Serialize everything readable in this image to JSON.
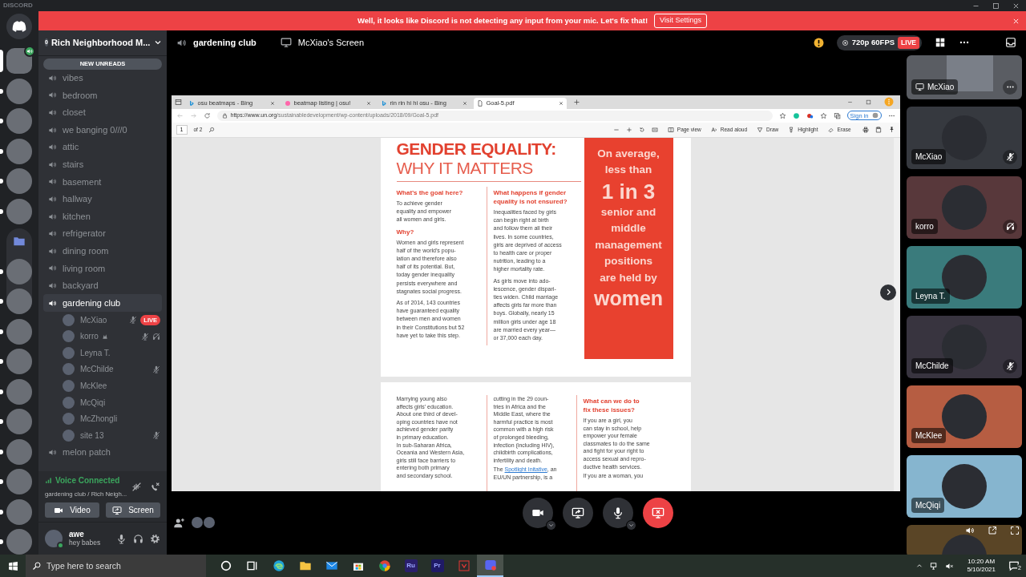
{
  "app": {
    "title": "DISCORD"
  },
  "notice": {
    "text": "Well, it looks like Discord is not detecting any input from your mic. Let's fix that!",
    "button": "Visit Settings"
  },
  "servers": [
    {
      "kind": "home",
      "selected": false,
      "unread": false,
      "in_voice": false
    },
    {
      "kind": "photo",
      "selected": true,
      "unread": false,
      "in_voice": true
    },
    {
      "kind": "photo",
      "selected": false,
      "unread": true,
      "in_voice": false
    },
    {
      "kind": "photo",
      "selected": false,
      "unread": true,
      "in_voice": false
    },
    {
      "kind": "photo",
      "selected": false,
      "unread": true,
      "in_voice": false
    },
    {
      "kind": "photo",
      "selected": false,
      "unread": true,
      "in_voice": false
    },
    {
      "kind": "photo",
      "selected": false,
      "unread": true,
      "in_voice": false
    },
    {
      "kind": "folder",
      "selected": false,
      "unread": false,
      "in_voice": false,
      "children": [
        {
          "kind": "photo",
          "selected": false,
          "unread": true,
          "in_voice": false
        },
        {
          "kind": "photo",
          "selected": false,
          "unread": true,
          "in_voice": false
        }
      ]
    },
    {
      "kind": "photo",
      "selected": false,
      "unread": true,
      "in_voice": false
    },
    {
      "kind": "photo",
      "selected": false,
      "unread": true,
      "in_voice": false
    },
    {
      "kind": "photo",
      "selected": false,
      "unread": true,
      "in_voice": false
    },
    {
      "kind": "photo",
      "selected": false,
      "unread": true,
      "in_voice": false
    },
    {
      "kind": "photo",
      "selected": false,
      "unread": true,
      "in_voice": false
    },
    {
      "kind": "photo",
      "selected": false,
      "unread": true,
      "in_voice": false
    },
    {
      "kind": "photo",
      "selected": false,
      "unread": true,
      "in_voice": false
    },
    {
      "kind": "photo",
      "selected": false,
      "unread": true,
      "in_voice": false
    }
  ],
  "server": {
    "name": "Rich Neighborhood M...",
    "boosts": "0",
    "new_unreads": "NEW UNREADS"
  },
  "channels": [
    {
      "name": "vibes",
      "selected": false
    },
    {
      "name": "bedroom",
      "selected": false
    },
    {
      "name": "closet",
      "selected": false
    },
    {
      "name": "we banging 0///0",
      "selected": false
    },
    {
      "name": "attic",
      "selected": false
    },
    {
      "name": "stairs",
      "selected": false
    },
    {
      "name": "basement",
      "selected": false
    },
    {
      "name": "hallway",
      "selected": false
    },
    {
      "name": "kitchen",
      "selected": false
    },
    {
      "name": "refrigerator",
      "selected": false
    },
    {
      "name": "dining room",
      "selected": false
    },
    {
      "name": "living room",
      "selected": false
    },
    {
      "name": "backyard",
      "selected": false
    },
    {
      "name": "gardening club",
      "selected": true,
      "members": [
        {
          "name": "McXiao",
          "muted": true,
          "deafened": false,
          "live": "LIVE"
        },
        {
          "name": "korro",
          "muted": true,
          "deafened": true
        },
        {
          "name": "Leyna T.",
          "muted": false,
          "deafened": false
        },
        {
          "name": "McChilde",
          "muted": true,
          "deafened": false
        },
        {
          "name": "McKlee",
          "muted": false,
          "deafened": false
        },
        {
          "name": "McQiqi",
          "muted": false,
          "deafened": false
        },
        {
          "name": "McZhongli",
          "muted": false,
          "deafened": false
        },
        {
          "name": "site 13",
          "muted": true,
          "deafened": false
        }
      ]
    },
    {
      "name": "melon patch",
      "selected": false
    }
  ],
  "voice": {
    "status": "Voice Connected",
    "location": "gardening club / Rich Neigh...",
    "buttons": [
      {
        "kind": "video",
        "label": "Video"
      },
      {
        "kind": "screen",
        "label": "Screen"
      }
    ]
  },
  "user": {
    "name": "awe",
    "status": "hey babes"
  },
  "header": {
    "channel": "gardening club",
    "stream": "McXiao's Screen",
    "quality": "720p 60FPS",
    "live": "LIVE"
  },
  "browser": {
    "tabs": [
      {
        "kind": "bing",
        "label": "osu beatmaps - Bing",
        "selected": false
      },
      {
        "kind": "osu",
        "label": "beatmap listing | osu!",
        "selected": false
      },
      {
        "kind": "bing",
        "label": "rin rin hi hi osu - Bing",
        "selected": false
      },
      {
        "kind": "doc",
        "label": "Goal-5.pdf",
        "selected": true
      }
    ],
    "url_host": "https://www.un.org",
    "url_path": "/sustainabledevelopment/wp-content/uploads/2018/09/Goal-5.pdf",
    "sign_in": "Sign in",
    "page": "1",
    "page_count": "of 2",
    "tools": [
      {
        "kind": "pageview",
        "label": "Page view"
      },
      {
        "kind": "read",
        "label": "Read aloud"
      },
      {
        "kind": "draw",
        "label": "Draw"
      },
      {
        "kind": "highlight",
        "label": "Highlight"
      },
      {
        "kind": "erase",
        "label": "Erase"
      }
    ]
  },
  "document": {
    "title": [
      "GENDER EQUALITY:",
      "WHY IT MATTERS"
    ],
    "page1_columns": [
      [
        {
          "kind": "heading",
          "lines": [
            "What’s the goal here?"
          ]
        },
        {
          "kind": "para",
          "lines": [
            "To achieve gender",
            "equality and empower",
            "all women and girls."
          ]
        },
        {
          "kind": "heading",
          "lines": [
            "Why?"
          ]
        },
        {
          "kind": "para",
          "lines": [
            "Women and girls represent",
            "half of the world’s popu-",
            "lation and therefore also",
            "half of its potential. But,",
            "today gender inequality",
            "persists everywhere and",
            "stagnates social progress."
          ]
        },
        {
          "kind": "para",
          "lines": [
            "As of 2014, 143 countries",
            "have guaranteed equality",
            "between men and women",
            "in their Constitutions but 52",
            "have yet to take this step."
          ]
        }
      ],
      [
        {
          "kind": "heading",
          "lines": [
            "What happens if gender",
            "equality is not ensured?"
          ]
        },
        {
          "kind": "para",
          "lines": [
            "Inequalities faced by girls",
            "can begin right at birth",
            "and follow them all their",
            "lives. In some countries,",
            "girls are deprived of access",
            "to health care or proper",
            "nutrition, leading to a",
            "higher mortality rate."
          ]
        },
        {
          "kind": "para",
          "lines": [
            "As girls move into ado-",
            "lescence, gender dispari-",
            "ties widen. Child marriage",
            "affects girls far more than",
            "boys. Globally, nearly 15",
            "million girls under age 18",
            "are married every year—",
            "or 37,000 each day."
          ]
        }
      ]
    ],
    "callout": [
      {
        "kind": "normal",
        "text": "On average,"
      },
      {
        "kind": "normal",
        "text": "less than"
      },
      {
        "kind": "big",
        "text": "1 in 3"
      },
      {
        "kind": "normal",
        "text": "senior and"
      },
      {
        "kind": "normal",
        "text": "middle"
      },
      {
        "kind": "normal",
        "text": "management"
      },
      {
        "kind": "normal",
        "text": "positions"
      },
      {
        "kind": "normal",
        "text": "are held by"
      },
      {
        "kind": "large",
        "text": "women"
      }
    ],
    "page2_columns": [
      [
        {
          "kind": "para",
          "lines": [
            "Marrying young also",
            "affects girls’ education.",
            "About one third of devel-",
            "oping countries have not",
            "achieved gender parity",
            "in primary education.",
            "In sub-Saharan Africa,",
            "Oceania and Western Asia,",
            "girls still face barriers to",
            "entering both primary",
            "and secondary school."
          ]
        }
      ],
      [
        {
          "kind": "para",
          "lines": [
            "cutting in the 29 coun-",
            "tries in Africa and the",
            "Middle East, where the",
            "harmful practice is most",
            "common with a high risk",
            "of prolonged bleeding,",
            "infection (including HIV),",
            "childbirth complications,",
            "infertility and death."
          ]
        },
        {
          "kind": "para",
          "lines": [
            {
              "before": "The ",
              "link": "Spotlight Initative",
              "after": ", an"
            },
            "EU/UN partnership, is a"
          ]
        }
      ],
      [
        {
          "kind": "heading",
          "lines": [
            "What can we do to",
            "fix these issues?"
          ]
        },
        {
          "kind": "para",
          "lines": [
            "If you are a girl, you",
            "can stay in school, help",
            "empower your female",
            "classmates to do the same",
            "and fight for your right to",
            "access sexual and repro-",
            "ductive health services."
          ]
        },
        {
          "kind": "para",
          "lines": [
            "If you are a woman, you"
          ]
        }
      ]
    ]
  },
  "tiles": [
    {
      "kind": "stream",
      "name": "McXiao",
      "color": "#5a5d63",
      "muted": false,
      "deafened": false
    },
    {
      "kind": "user",
      "name": "McXiao",
      "color": "#36393f",
      "muted": true,
      "deafened": false
    },
    {
      "kind": "user",
      "name": "korro",
      "color": "#58383b",
      "muted": false,
      "deafened": true
    },
    {
      "kind": "user",
      "name": "Leyna T.",
      "color": "#3a7b7c",
      "muted": false,
      "deafened": false
    },
    {
      "kind": "user",
      "name": "McChilde",
      "color": "#38343f",
      "muted": true,
      "deafened": false
    },
    {
      "kind": "user",
      "name": "McKlee",
      "color": "#b65d42",
      "muted": false,
      "deafened": false
    },
    {
      "kind": "user",
      "name": "McQiqi",
      "color": "#86b5cf",
      "muted": false,
      "deafened": false
    },
    {
      "kind": "partial",
      "color": "#5a4526",
      "muted": false,
      "deafened": false
    }
  ],
  "taskbar": {
    "search_placeholder": "Type here to search",
    "apps": [
      {
        "kind": "cortana",
        "selected": false
      },
      {
        "kind": "taskview",
        "selected": false
      },
      {
        "kind": "edge",
        "selected": false
      },
      {
        "kind": "explorer",
        "selected": false
      },
      {
        "kind": "mail",
        "selected": false
      },
      {
        "kind": "store",
        "selected": false
      },
      {
        "kind": "chrome",
        "selected": false
      },
      {
        "kind": "label",
        "label": "Ru",
        "color": "#2a1f6b",
        "selected": false
      },
      {
        "kind": "label",
        "label": "Pr",
        "color": "#1f1a66",
        "selected": false
      },
      {
        "kind": "vivaldi",
        "selected": false
      },
      {
        "kind": "discord",
        "selected": true
      }
    ],
    "time": "10:20 AM",
    "date": "5/10/2021",
    "notifications": "2"
  }
}
